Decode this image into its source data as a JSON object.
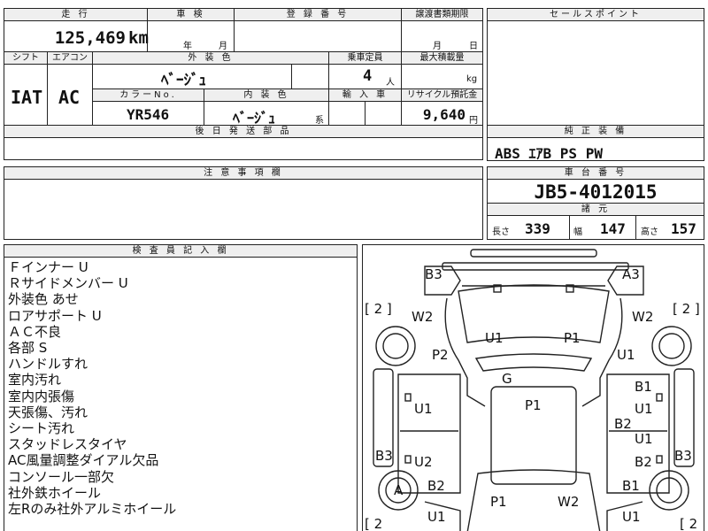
{
  "top": {
    "h_mileage": "走 行",
    "h_inspection": "車 検",
    "h_regno": "登 録 番 号",
    "h_transfer": "譲渡書類期限",
    "mileage_value": "125,469",
    "mileage_unit": "km",
    "insp_year": "年",
    "insp_month": "月",
    "transfer_month": "月",
    "transfer_day": "日",
    "h_shift": "シフト",
    "h_ac": "エアコン",
    "h_exterior": "外 装 色",
    "h_capacity": "乗車定員",
    "h_maxload": "最大積載量",
    "shift_value": "IAT",
    "ac_value": "AC",
    "exterior_value": "ﾍﾞｰｼﾞｭ",
    "capacity_value": "4",
    "capacity_unit": "人",
    "maxload_unit": "kg",
    "h_colorno": "カラーNo.",
    "h_interior": "内 装 色",
    "h_import": "輸 入 車",
    "h_recycle": "リサイクル預託金",
    "colorno_value": "YR546",
    "interior_value": "ﾍﾞｰｼﾞｭ",
    "interior_suffix": "系",
    "recycle_value": "9,640",
    "recycle_unit": "円",
    "h_later": "後 日 発 送 部 品"
  },
  "sales": {
    "header": "セールスポイント"
  },
  "equipment": {
    "header": "純 正 装 備",
    "value": "ABS ｴｱB PS PW"
  },
  "caution": {
    "header": "注 意 事 項 欄"
  },
  "chassis": {
    "header": "車 台 番 号",
    "value": "JB5-4012015",
    "spec_header": "諸 元",
    "length_label": "長さ",
    "length_value": "339",
    "width_label": "幅",
    "width_value": "147",
    "height_label": "高さ",
    "height_value": "157"
  },
  "inspector": {
    "header": "検 査 員 記 入 欄",
    "notes": [
      "Ｆインナー U",
      "Ｒサイドメンバー U",
      "外装色 あせ",
      "ロアサポート U",
      "ＡＣ不良",
      "各部 S",
      "ハンドルすれ",
      "室内汚れ",
      "室内内張傷",
      "天張傷、汚れ",
      "シート汚れ",
      "スタッドレスタイヤ",
      "AC風量調整ダイアル欠品",
      "コンソール一部欠",
      "社外鉄ホイール",
      "左Rのみ社外アルミホイール"
    ]
  },
  "diagram": {
    "labels": {
      "b3_tl": "B3",
      "a3_tr": "A3",
      "tire_fl": "[ 2 ]",
      "tire_fr": "[ 2 ]",
      "tire_rl": "[ 2",
      "tire_rr": "[ 2",
      "w2_l": "W2",
      "w2_r": "W2",
      "u1_hood": "U1",
      "p1_hood": "P1",
      "p2_left": "P2",
      "u1_right": "U1",
      "g_glass": "G",
      "b1_r1": "B1",
      "u1_r2": "U1",
      "p1_roof": "P1",
      "u1_l1": "U1",
      "b2_r": "B2",
      "u1_r3": "U1",
      "b3_l": "B3",
      "b3_r": "B3",
      "u2_l": "U2",
      "b2_r2": "B2",
      "a_wheel": "A",
      "b2_l": "B2",
      "b1_r3": "B1",
      "p1_rear": "P1",
      "w2_rear": "W2",
      "u1_bl": "U1",
      "u1_br": "U1"
    }
  }
}
